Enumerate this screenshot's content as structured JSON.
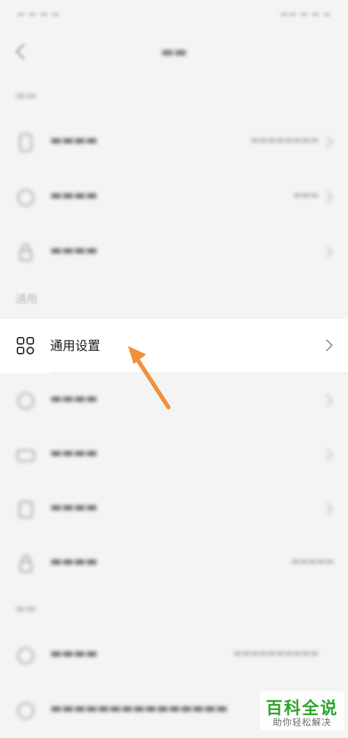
{
  "section_general": {
    "title": "通用"
  },
  "general_settings": {
    "label": "通用设置",
    "icon": "grid-icon"
  },
  "highlight": {
    "arrow_color": "#f0913a"
  },
  "watermark": {
    "title": "百科全说",
    "subtitle": "助你轻松解决"
  },
  "colors": {
    "background": "#f4f4f4",
    "active_row": "#ffffff",
    "brand_green": "#2ba42a"
  }
}
